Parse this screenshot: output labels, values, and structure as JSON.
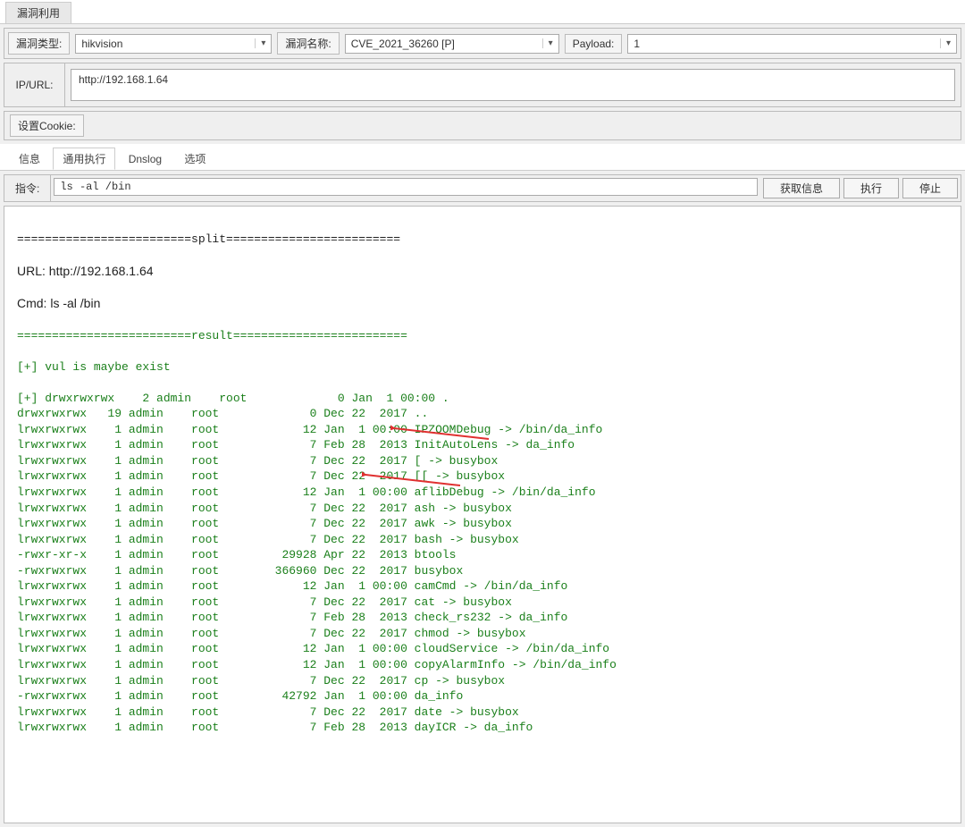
{
  "top_tab": "漏洞利用",
  "vuln_type_label": "漏洞类型:",
  "vuln_type_value": "hikvision",
  "vuln_name_label": "漏洞名称:",
  "vuln_name_value": "CVE_2021_36260 [P]",
  "payload_label": "Payload:",
  "payload_value": "1",
  "ipurl_label": "IP/URL:",
  "ipurl_value": "http://192.168.1.64",
  "cookie_label": "设置Cookie:",
  "sub_tabs": {
    "info": "信息",
    "exec": "通用执行",
    "dnslog": "Dnslog",
    "options": "选项"
  },
  "cmd_label": "指令:",
  "cmd_value": "ls -al /bin",
  "buttons": {
    "get_info": "获取信息",
    "execute": "执行",
    "stop": "停止"
  },
  "output": {
    "split_sep": "=========================split=========================",
    "url_line": "URL: http://192.168.1.64",
    "cmd_line": "Cmd: ls -al /bin",
    "result_sep": "=========================result=========================",
    "vul_line": "[+] vul is maybe exist",
    "listing": [
      "[+] drwxrwxrwx    2 admin    root             0 Jan  1 00:00 .",
      "drwxrwxrwx   19 admin    root             0 Dec 22  2017 ..",
      "lrwxrwxrwx    1 admin    root            12 Jan  1 00:00 IPZOOMDebug -> /bin/da_info",
      "lrwxrwxrwx    1 admin    root             7 Feb 28  2013 InitAutoLens -> da_info",
      "lrwxrwxrwx    1 admin    root             7 Dec 22  2017 [ -> busybox",
      "lrwxrwxrwx    1 admin    root             7 Dec 22  2017 [[ -> busybox",
      "lrwxrwxrwx    1 admin    root            12 Jan  1 00:00 aflibDebug -> /bin/da_info",
      "lrwxrwxrwx    1 admin    root             7 Dec 22  2017 ash -> busybox",
      "lrwxrwxrwx    1 admin    root             7 Dec 22  2017 awk -> busybox",
      "lrwxrwxrwx    1 admin    root             7 Dec 22  2017 bash -> busybox",
      "-rwxr-xr-x    1 admin    root         29928 Apr 22  2013 btools",
      "-rwxrwxrwx    1 admin    root        366960 Dec 22  2017 busybox",
      "lrwxrwxrwx    1 admin    root            12 Jan  1 00:00 camCmd -> /bin/da_info",
      "lrwxrwxrwx    1 admin    root             7 Dec 22  2017 cat -> busybox",
      "lrwxrwxrwx    1 admin    root             7 Feb 28  2013 check_rs232 -> da_info",
      "lrwxrwxrwx    1 admin    root             7 Dec 22  2017 chmod -> busybox",
      "lrwxrwxrwx    1 admin    root            12 Jan  1 00:00 cloudService -> /bin/da_info",
      "lrwxrwxrwx    1 admin    root            12 Jan  1 00:00 copyAlarmInfo -> /bin/da_info",
      "lrwxrwxrwx    1 admin    root             7 Dec 22  2017 cp -> busybox",
      "-rwxrwxrwx    1 admin    root         42792 Jan  1 00:00 da_info",
      "lrwxrwxrwx    1 admin    root             7 Dec 22  2017 date -> busybox",
      "lrwxrwxrwx    1 admin    root             7 Feb 28  2013 dayICR -> da_info"
    ]
  }
}
